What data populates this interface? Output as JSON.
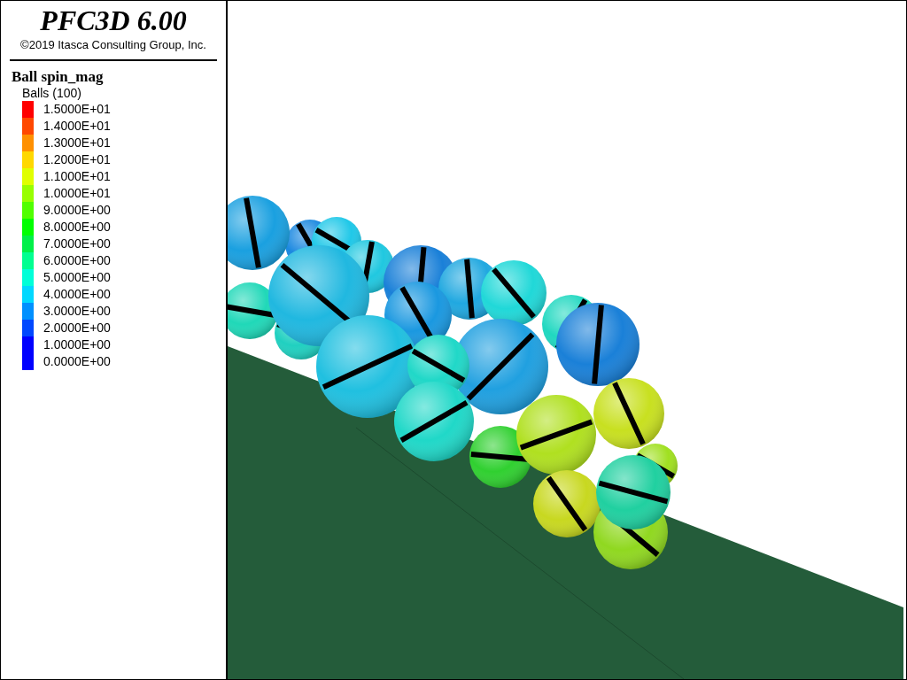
{
  "title": "PFC3D 6.00",
  "copyright": "©2019 Itasca Consulting Group, Inc.",
  "legend": {
    "title": "Ball spin_mag",
    "subtitle": "Balls (100)",
    "entries": [
      {
        "label": "1.5000E+01",
        "color": "#ff0000"
      },
      {
        "label": "1.4000E+01",
        "color": "#ff4800"
      },
      {
        "label": "1.3000E+01",
        "color": "#ff9000"
      },
      {
        "label": "1.2000E+01",
        "color": "#ffd800"
      },
      {
        "label": "1.1000E+01",
        "color": "#e0ff00"
      },
      {
        "label": "1.0000E+01",
        "color": "#98ff00"
      },
      {
        "label": "9.0000E+00",
        "color": "#50ff00"
      },
      {
        "label": "8.0000E+00",
        "color": "#00ff00"
      },
      {
        "label": "7.0000E+00",
        "color": "#00f048"
      },
      {
        "label": "6.0000E+00",
        "color": "#00ff90"
      },
      {
        "label": "5.0000E+00",
        "color": "#00ffd8"
      },
      {
        "label": "4.0000E+00",
        "color": "#00d8ff"
      },
      {
        "label": "3.0000E+00",
        "color": "#0090ff"
      },
      {
        "label": "2.0000E+00",
        "color": "#0048ff"
      },
      {
        "label": "1.0000E+00",
        "color": "#0000ff"
      },
      {
        "label": "0.0000E+00",
        "color": "#0000ff"
      }
    ]
  }
}
